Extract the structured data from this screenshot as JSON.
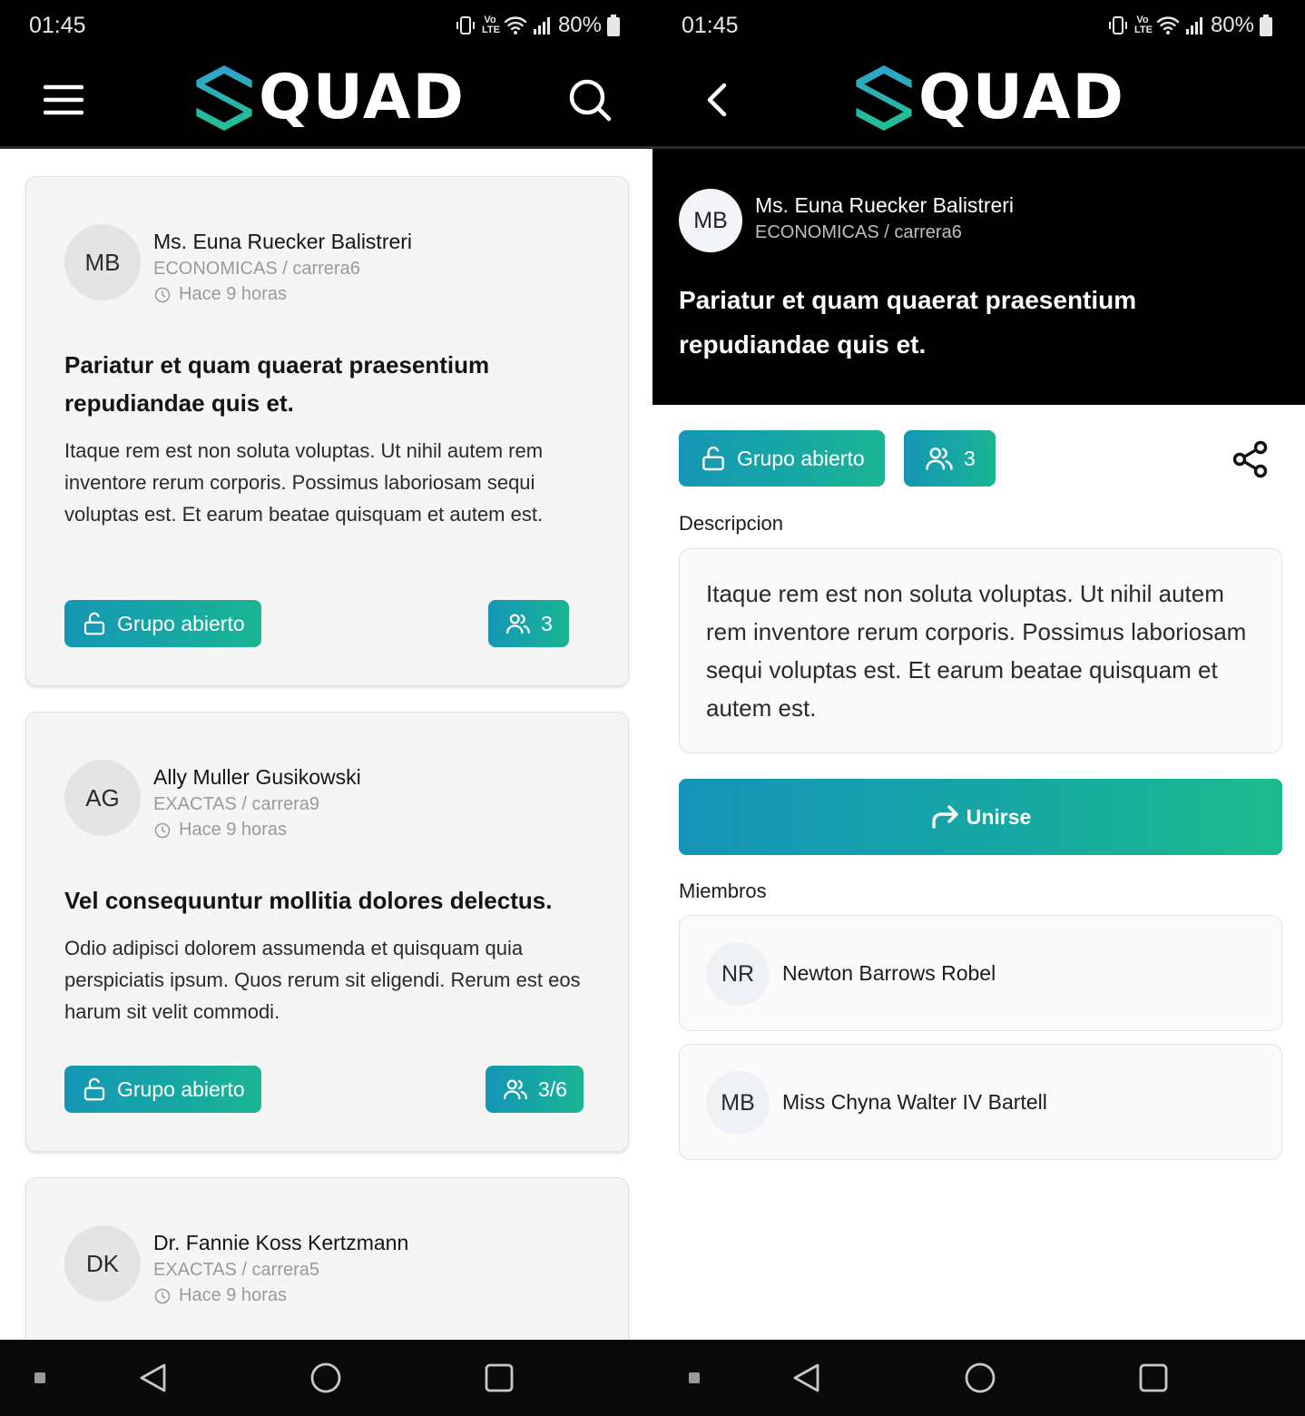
{
  "status_bar": {
    "time": "01:45",
    "battery": "80%",
    "tag_top": "Vo",
    "tag_bottom": "LTE"
  },
  "brand": {
    "name": "QUAD",
    "accent_top": "#2ea2cf",
    "accent_bottom": "#21c28f"
  },
  "feed": {
    "posts": [
      {
        "initials": "MB",
        "author": "Ms. Euna Ruecker Balistreri",
        "career": "ECONOMICAS / carrera6",
        "time_ago": "Hace 9 horas",
        "title": "Pariatur et quam quaerat praesentium repudiandae quis et.",
        "body": "Itaque rem est non soluta voluptas. Ut nihil autem rem inventore rerum corporis. Possimus laboriosam sequi voluptas est. Et earum beatae quisquam et autem est.",
        "status": "Grupo abierto",
        "members": "3"
      },
      {
        "initials": "AG",
        "author": "Ally Muller Gusikowski",
        "career": "EXACTAS / carrera9",
        "time_ago": "Hace 9 horas",
        "title": "Vel consequuntur mollitia dolores delectus.",
        "body": "Odio adipisci dolorem assumenda et quisquam quia perspiciatis ipsum. Quos rerum sit eligendi. Rerum est eos harum sit velit commodi.",
        "status": "Grupo abierto",
        "members": "3/6"
      },
      {
        "initials": "DK",
        "author": "Dr. Fannie Koss Kertzmann",
        "career": "EXACTAS / carrera5",
        "time_ago": "Hace 9 horas"
      }
    ]
  },
  "detail": {
    "initials": "MB",
    "author": "Ms. Euna Ruecker Balistreri",
    "career": "ECONOMICAS / carrera6",
    "title": "Pariatur et quam quaerat praesentium repudiandae quis et.",
    "status": "Grupo abierto",
    "members_count": "3",
    "description_label": "Descripcion",
    "description": "Itaque rem est non soluta voluptas. Ut nihil autem rem inventore rerum corporis. Possimus laboriosam sequi voluptas est. Et earum beatae quisquam et autem est.",
    "join_label": "Unirse",
    "members_label": "Miembros",
    "members": [
      {
        "initials": "NR",
        "name": "Newton Barrows Robel"
      },
      {
        "initials": "MB",
        "name": "Miss Chyna Walter IV Bartell"
      }
    ]
  }
}
